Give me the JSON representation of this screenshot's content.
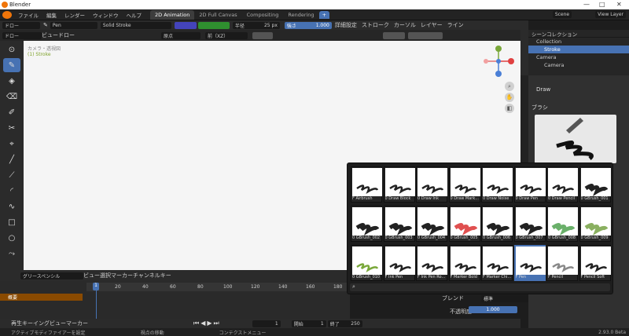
{
  "window": {
    "title": "Blender",
    "minimize": "—",
    "maximize": "□",
    "close": "✕"
  },
  "menubar": {
    "items": [
      "ファイル",
      "編集",
      "レンダー",
      "ウィンドウ",
      "ヘルプ"
    ],
    "tabs": [
      {
        "label": "2D Animation",
        "active": true
      },
      {
        "label": "2D Full Canvas"
      },
      {
        "label": "Compositing"
      },
      {
        "label": "Rendering"
      },
      {
        "label": "+"
      }
    ],
    "scene": "Scene",
    "view_layer": "View Layer"
  },
  "toolhdr": {
    "mode": "ドロー",
    "brush": "Pen",
    "material": "Solid Stroke",
    "radius_label": "半径",
    "radius_value": "25 px",
    "strength_label": "強さ",
    "strength_value": "1.000",
    "settings": "詳細設定",
    "stroke": "ストローク",
    "cursor": "カーソル",
    "layer": "レイヤー",
    "line": "ライン"
  },
  "vphdr": {
    "mode": "ドロー",
    "view": "ビュー",
    "draw": "ドロー",
    "origin": "原点",
    "axis": "前（XZ）"
  },
  "viewport": {
    "camera_label": "カメラ・透視図",
    "object_label": "(1) Stroke"
  },
  "outliner": {
    "title": "シーンコレクション",
    "rows": [
      {
        "label": "Collection",
        "indent": 0
      },
      {
        "label": "Stroke",
        "indent": 1,
        "selected": true
      },
      {
        "label": "Camera",
        "indent": 0
      },
      {
        "label": "Camera",
        "indent": 1
      }
    ]
  },
  "props": {
    "tool_name": "Draw",
    "section": "ブラシ",
    "blend_label": "ブレンド",
    "blend_value": "標準",
    "opacity_label": "不透明度",
    "opacity_value": "1.000"
  },
  "brushes": [
    {
      "label": "F Airbrush"
    },
    {
      "label": "0 Draw Block"
    },
    {
      "label": "0 Draw Ink"
    },
    {
      "label": "0 Draw Mark..."
    },
    {
      "label": "0 Draw Noise"
    },
    {
      "label": "0 Draw Pen"
    },
    {
      "label": "0 Draw Pencil"
    },
    {
      "label": "0 GBrush_001"
    },
    {
      "label": "0 GBrush_002"
    },
    {
      "label": "0 GBrush_003"
    },
    {
      "label": "0 GBrush_004"
    },
    {
      "label": "0 GBrush_005"
    },
    {
      "label": "0 GBrush_006"
    },
    {
      "label": "0 GBrush_007"
    },
    {
      "label": "0 GBrush_008"
    },
    {
      "label": "0 GBrush_009"
    },
    {
      "label": "0 GBrush_010"
    },
    {
      "label": "F Ink Pen"
    },
    {
      "label": "F Ink Pen Ro..."
    },
    {
      "label": "F Marker Bold"
    },
    {
      "label": "F Marker Chi..."
    },
    {
      "label": "F Pen",
      "selected": true
    },
    {
      "label": "F Pencil"
    },
    {
      "label": "F Pencil Soft"
    }
  ],
  "timeline": {
    "editor": "グリースペンシル",
    "menus": [
      "ビュー",
      "選択",
      "マーカー",
      "チャンネル",
      "キー"
    ],
    "summary": "概要",
    "ticks": [
      "1",
      "20",
      "40",
      "60",
      "80",
      "100",
      "120",
      "140",
      "160",
      "180"
    ],
    "current": "1"
  },
  "footer": {
    "menus": [
      "再生",
      "キーイング",
      "ビュー",
      "マーカー"
    ],
    "frame": "1",
    "start_label": "開始",
    "start": "1",
    "end_label": "終了",
    "end": "250"
  },
  "status": {
    "left": "アクティブモディファイアーを設定",
    "mid": "視点の移動",
    "right": "コンテクストメニュー",
    "version": "2.93.0 Beta"
  }
}
